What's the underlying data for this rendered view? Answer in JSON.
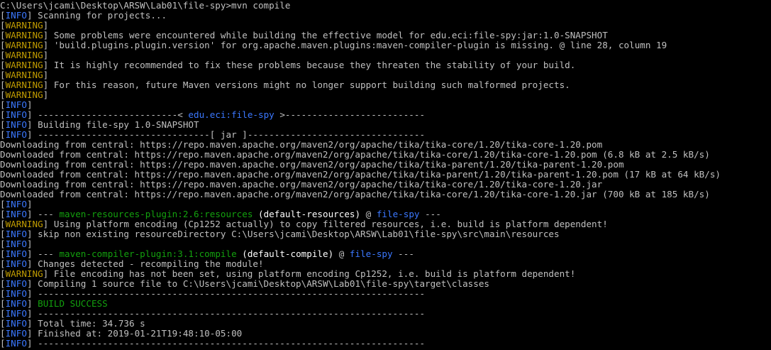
{
  "window": {
    "app": "Command Prompt"
  },
  "colors": {
    "background": "#000000",
    "text": "#c0c0c0",
    "info_tag": "#3b78ff",
    "warning_tag": "#c19c00",
    "success": "#13a10e",
    "plugin_name": "#13a10e",
    "artifact": "#3b78ff"
  },
  "terminal": {
    "lines": [
      {
        "tag": null,
        "segments": [
          {
            "t": "C:\\Users\\jcami\\Desktop\\ARSW\\Lab01\\file-spy>mvn compile",
            "c": "default"
          }
        ]
      },
      {
        "tag": "INFO",
        "segments": [
          {
            "t": " Scanning for projects...",
            "c": "default"
          }
        ]
      },
      {
        "tag": "WARNING",
        "segments": []
      },
      {
        "tag": "WARNING",
        "segments": [
          {
            "t": " Some problems were encountered while building the effective model for edu.eci:file-spy:jar:1.0-SNAPSHOT",
            "c": "default"
          }
        ]
      },
      {
        "tag": "WARNING",
        "segments": [
          {
            "t": " 'build.plugins.plugin.version' for org.apache.maven.plugins:maven-compiler-plugin is missing. @ line 28, column 19",
            "c": "default"
          }
        ]
      },
      {
        "tag": "WARNING",
        "segments": []
      },
      {
        "tag": "WARNING",
        "segments": [
          {
            "t": " It is highly recommended to fix these problems because they threaten the stability of your build.",
            "c": "default"
          }
        ]
      },
      {
        "tag": "WARNING",
        "segments": []
      },
      {
        "tag": "WARNING",
        "segments": [
          {
            "t": " For this reason, future Maven versions might no longer support building such malformed projects.",
            "c": "default"
          }
        ]
      },
      {
        "tag": "WARNING",
        "segments": []
      },
      {
        "tag": "INFO",
        "segments": []
      },
      {
        "tag": "INFO",
        "segments": [
          {
            "t": " --------------------------< ",
            "c": "default"
          },
          {
            "t": "edu.eci:file-spy",
            "c": "blue"
          },
          {
            "t": " >--------------------------",
            "c": "default"
          }
        ]
      },
      {
        "tag": "INFO",
        "segments": [
          {
            "t": " Building file-spy 1.0-SNAPSHOT",
            "c": "default"
          }
        ]
      },
      {
        "tag": "INFO",
        "segments": [
          {
            "t": " --------------------------------[ jar ]---------------------------------",
            "c": "default"
          }
        ]
      },
      {
        "tag": null,
        "segments": [
          {
            "t": "Downloading from central: https://repo.maven.apache.org/maven2/org/apache/tika/tika-core/1.20/tika-core-1.20.pom",
            "c": "default"
          }
        ]
      },
      {
        "tag": null,
        "segments": [
          {
            "t": "Downloaded from central: https://repo.maven.apache.org/maven2/org/apache/tika/tika-core/1.20/tika-core-1.20.pom (6.8 kB at 2.5 kB/s)",
            "c": "default"
          }
        ]
      },
      {
        "tag": null,
        "segments": [
          {
            "t": "Downloading from central: https://repo.maven.apache.org/maven2/org/apache/tika/tika-parent/1.20/tika-parent-1.20.pom",
            "c": "default"
          }
        ]
      },
      {
        "tag": null,
        "segments": [
          {
            "t": "Downloaded from central: https://repo.maven.apache.org/maven2/org/apache/tika/tika-parent/1.20/tika-parent-1.20.pom (17 kB at 64 kB/s)",
            "c": "default"
          }
        ]
      },
      {
        "tag": null,
        "segments": [
          {
            "t": "Downloading from central: https://repo.maven.apache.org/maven2/org/apache/tika/tika-core/1.20/tika-core-1.20.jar",
            "c": "default"
          }
        ]
      },
      {
        "tag": null,
        "segments": [
          {
            "t": "Downloaded from central: https://repo.maven.apache.org/maven2/org/apache/tika/tika-core/1.20/tika-core-1.20.jar (700 kB at 185 kB/s)",
            "c": "default"
          }
        ]
      },
      {
        "tag": "INFO",
        "segments": []
      },
      {
        "tag": "INFO",
        "segments": [
          {
            "t": " --- ",
            "c": "default"
          },
          {
            "t": "maven-resources-plugin:2.6:resources",
            "c": "green"
          },
          {
            "t": " (default-resources)",
            "c": "bold"
          },
          {
            "t": " @ ",
            "c": "default"
          },
          {
            "t": "file-spy",
            "c": "blue"
          },
          {
            "t": " ---",
            "c": "default"
          }
        ]
      },
      {
        "tag": "WARNING",
        "segments": [
          {
            "t": " Using platform encoding (Cp1252 actually) to copy filtered resources, i.e. build is platform dependent!",
            "c": "default"
          }
        ]
      },
      {
        "tag": "INFO",
        "segments": [
          {
            "t": " skip non existing resourceDirectory C:\\Users\\jcami\\Desktop\\ARSW\\Lab01\\file-spy\\src\\main\\resources",
            "c": "default"
          }
        ]
      },
      {
        "tag": "INFO",
        "segments": []
      },
      {
        "tag": "INFO",
        "segments": [
          {
            "t": " --- ",
            "c": "default"
          },
          {
            "t": "maven-compiler-plugin:3.1:compile",
            "c": "green"
          },
          {
            "t": " (default-compile)",
            "c": "bold"
          },
          {
            "t": " @ ",
            "c": "default"
          },
          {
            "t": "file-spy",
            "c": "blue"
          },
          {
            "t": " ---",
            "c": "default"
          }
        ]
      },
      {
        "tag": "INFO",
        "segments": [
          {
            "t": " Changes detected - recompiling the module!",
            "c": "default"
          }
        ]
      },
      {
        "tag": "WARNING",
        "segments": [
          {
            "t": " File encoding has not been set, using platform encoding Cp1252, i.e. build is platform dependent!",
            "c": "default"
          }
        ]
      },
      {
        "tag": "INFO",
        "segments": [
          {
            "t": " Compiling 1 source file to C:\\Users\\jcami\\Desktop\\ARSW\\Lab01\\file-spy\\target\\classes",
            "c": "default"
          }
        ]
      },
      {
        "tag": "INFO",
        "segments": [
          {
            "t": " ------------------------------------------------------------------------",
            "c": "default"
          }
        ]
      },
      {
        "tag": "INFO",
        "segments": [
          {
            "t": " ",
            "c": "default"
          },
          {
            "t": "BUILD SUCCESS",
            "c": "green"
          }
        ]
      },
      {
        "tag": "INFO",
        "segments": [
          {
            "t": " ------------------------------------------------------------------------",
            "c": "default"
          }
        ]
      },
      {
        "tag": "INFO",
        "segments": [
          {
            "t": " Total time: 34.736 s",
            "c": "default"
          }
        ]
      },
      {
        "tag": "INFO",
        "segments": [
          {
            "t": " Finished at: 2019-01-21T19:48:10-05:00",
            "c": "default"
          }
        ]
      },
      {
        "tag": "INFO",
        "segments": [
          {
            "t": " ------------------------------------------------------------------------",
            "c": "default"
          }
        ]
      }
    ]
  }
}
